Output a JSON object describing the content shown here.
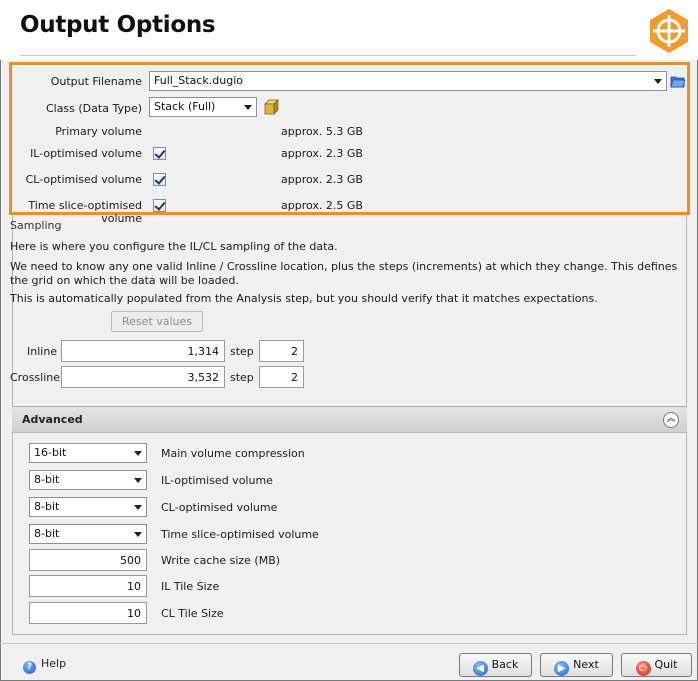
{
  "page": {
    "title": "Output Options"
  },
  "output": {
    "filename_label": "Output Filename",
    "filename_value": "Full_Stack.dugio",
    "class_label": "Class (Data Type)",
    "class_value": "Stack (Full)",
    "rows": [
      {
        "label": "Primary volume",
        "size": "approx. 5.3 GB",
        "checkbox": false
      },
      {
        "label": "IL-optimised volume",
        "size": "approx. 2.3 GB",
        "checkbox": true,
        "checked": true
      },
      {
        "label": "CL-optimised volume",
        "size": "approx. 2.3 GB",
        "checkbox": true,
        "checked": true
      },
      {
        "label": "Time slice-optimised volume",
        "size": "approx. 2.5 GB",
        "checkbox": true,
        "checked": true
      }
    ]
  },
  "sampling": {
    "title": "Sampling",
    "line1": "Here is where you configure the IL/CL sampling of the data.",
    "line2": "We need to know any one valid Inline / Crossline location, plus the steps (increments) at which they change. This defines the grid on which the data will be loaded.",
    "line3": "This is automatically populated from the Analysis step, but you should verify that it matches expectations.",
    "reset_label": "Reset values",
    "inline_label": "Inline",
    "inline_value": "1,314",
    "crossline_label": "Crossline",
    "crossline_value": "3,532",
    "step_label": "step",
    "inline_step": "2",
    "crossline_step": "2"
  },
  "advanced": {
    "title": "Advanced",
    "selects": [
      {
        "value": "16-bit",
        "label": "Main volume compression"
      },
      {
        "value": "8-bit",
        "label": "IL-optimised volume"
      },
      {
        "value": "8-bit",
        "label": "CL-optimised volume"
      },
      {
        "value": "8-bit",
        "label": "Time slice-optimised volume"
      }
    ],
    "fields": [
      {
        "value": "500",
        "label": "Write cache size (MB)"
      },
      {
        "value": "10",
        "label": "IL Tile Size"
      },
      {
        "value": "10",
        "label": "CL Tile Size"
      }
    ]
  },
  "footer": {
    "help": "Help",
    "back": "Back",
    "next": "Next",
    "quit": "Quit"
  },
  "colors": {
    "highlight": "#ee8d2e",
    "logo": "#f29b2e"
  }
}
